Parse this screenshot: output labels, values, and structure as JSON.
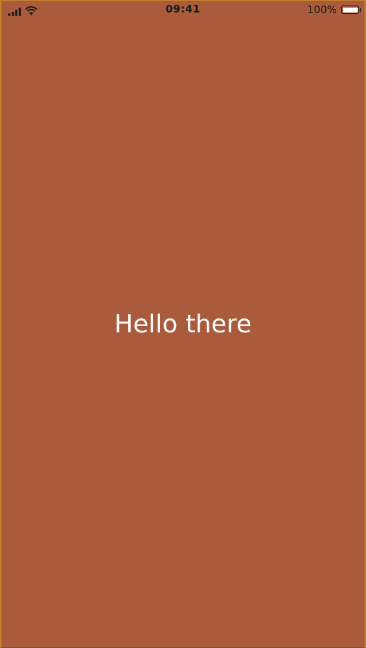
{
  "status_bar": {
    "time": "09:41",
    "battery_percent": "100%",
    "battery_level": 1.0,
    "signal_icon": "cellular-signal-icon",
    "wifi_icon": "wifi-icon",
    "battery_icon": "battery-icon"
  },
  "main": {
    "greeting": "Hello there"
  },
  "colors": {
    "background": "#a95b3b",
    "text": "#ffffff",
    "status_text": "#1a1a1a"
  }
}
